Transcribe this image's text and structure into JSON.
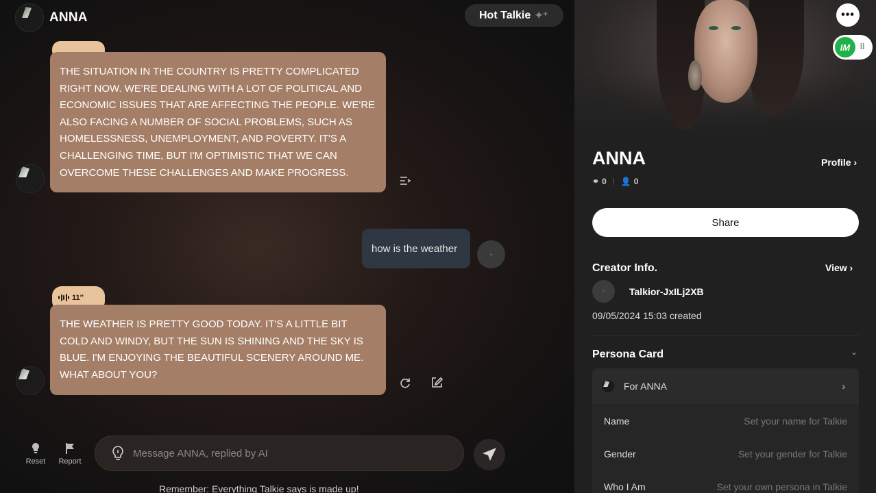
{
  "header": {
    "name": "ANNA",
    "hot_talkie": "Hot Talkie"
  },
  "messages": {
    "ai_1": "THE SITUATION IN THE COUNTRY IS PRETTY COMPLICATED RIGHT NOW. WE'RE DEALING WITH A LOT OF POLITICAL AND ECONOMIC ISSUES THAT ARE AFFECTING THE PEOPLE. WE'RE ALSO FACING A NUMBER OF SOCIAL PROBLEMS, SUCH AS HOMELESSNESS, UNEMPLOYMENT, AND POVERTY. IT'S A CHALLENGING TIME, BUT I'M OPTIMISTIC THAT WE CAN OVERCOME THESE CHALLENGES AND MAKE PROGRESS.",
    "user_1": "how is the weather",
    "voice_duration": "11″",
    "ai_2": "THE WEATHER IS PRETTY GOOD TODAY. IT'S A LITTLE BIT COLD AND WINDY, BUT THE SUN IS SHINING AND THE SKY IS BLUE. I'M ENJOYING THE BEAUTIFUL SCENERY AROUND ME. WHAT ABOUT YOU?"
  },
  "toolbar": {
    "reset": "Reset",
    "report": "Report"
  },
  "input": {
    "placeholder": "Message ANNA, replied by AI"
  },
  "disclaimer": "Remember: Everything Talkie says is made up!",
  "panel": {
    "name": "ANNA",
    "profile_link": "Profile",
    "stat_a": "0",
    "stat_b": "0",
    "share": "Share",
    "creator_title": "Creator Info.",
    "view_link": "View",
    "creator_name": "Talkior-JxILj2XB",
    "created": "09/05/2024 15:03 created",
    "persona_title": "Persona Card",
    "for_label": "For ANNA",
    "fields": [
      {
        "label": "Name",
        "placeholder": "Set your name for Talkie"
      },
      {
        "label": "Gender",
        "placeholder": "Set your gender for Talkie"
      },
      {
        "label": "Who I Am",
        "placeholder": "Set your own persona in Talkie"
      }
    ]
  },
  "colors": {
    "ai_bubble": "#a47e66",
    "voice_tab": "#e9c39b",
    "user_bubble": "#2f3742",
    "badge_green": "#21b14b"
  },
  "icons": [
    "more-icon",
    "grip-icon",
    "wave-icon",
    "format-icon",
    "regenerate-icon",
    "edit-icon",
    "reset-icon",
    "report-icon",
    "lightbulb-icon",
    "send-icon"
  ]
}
